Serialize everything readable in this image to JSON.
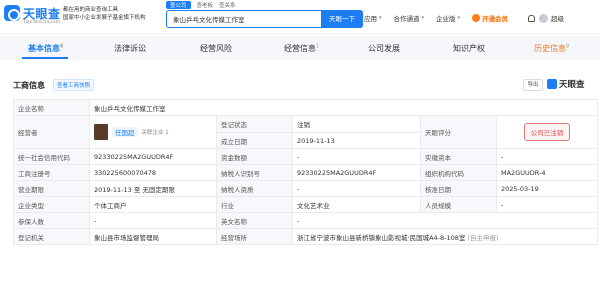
{
  "header": {
    "logo_name": "天眼查",
    "logo_url": "TianYanCha.com",
    "slogan_line1": "都在用的商业查询工具",
    "slogan_line2": "国家中小企业发展子基金旗下机构",
    "search_tabs": [
      "查公司",
      "查老板",
      "查关系"
    ],
    "search_value": "象山乒乓文化传媒工作室",
    "search_button": "天眼一下",
    "nav": [
      "应用",
      "合作通道",
      "企业版",
      "开通会员",
      "超级"
    ]
  },
  "tabs": [
    {
      "label": "基本信息",
      "count": "6"
    },
    {
      "label": "法律诉讼",
      "count": ""
    },
    {
      "label": "经营风险",
      "count": ""
    },
    {
      "label": "经营信息",
      "count": "1"
    },
    {
      "label": "公司发展",
      "count": ""
    },
    {
      "label": "知识产权",
      "count": ""
    },
    {
      "label": "历史信息",
      "count": "8"
    }
  ],
  "section": {
    "title": "工商信息",
    "link": "查看工商快照",
    "export": "导出",
    "brand": "天眼查"
  },
  "info": {
    "company_name_label": "企业名称",
    "company_name": "象山乒乓文化传媒工作室",
    "operator_label": "经营者",
    "operator_name": "任国超",
    "operator_rel": "关联企业 1",
    "reg_status_label": "登记状态",
    "reg_status": "注销",
    "found_date_label": "成立日期",
    "found_date": "2019-11-13",
    "rating_label": "天眼评分",
    "rating_stamp": "公司已注销",
    "credit_code_label": "统一社会信用代码",
    "credit_code": "92330225MA2GUUDR4F",
    "capital_label": "资金数额",
    "capital": "-",
    "paid_capital_label": "实缴资本",
    "paid_capital": "-",
    "reg_no_label": "工商注册号",
    "reg_no": "330225600070478",
    "taxpayer_id_label": "纳税人识别号",
    "taxpayer_id": "92330225MA2GUUDR4F",
    "org_code_label": "组织机构代码",
    "org_code": "MA2GUUDR-4",
    "term_label": "营业期限",
    "term": "2019-11-13 至 无固定期限",
    "taxpayer_qual_label": "纳税人资质",
    "taxpayer_qual": "-",
    "approve_date_label": "核准日期",
    "approve_date": "2025-03-19",
    "type_label": "企业类型",
    "type": "个体工商户",
    "industry_label": "行业",
    "industry": "文化艺术业",
    "staff_label": "人员规模",
    "staff": "-",
    "insured_label": "参保人数",
    "insured": "-",
    "english_label": "英文名称",
    "english": "-",
    "authority_label": "登记机关",
    "authority": "象山县市场监督管理局",
    "address_label": "经营场所",
    "address": "浙江省宁波市象山县新桥镇象山影视城·民国城A4-8-108室",
    "address_tail": "(自主申报)"
  }
}
